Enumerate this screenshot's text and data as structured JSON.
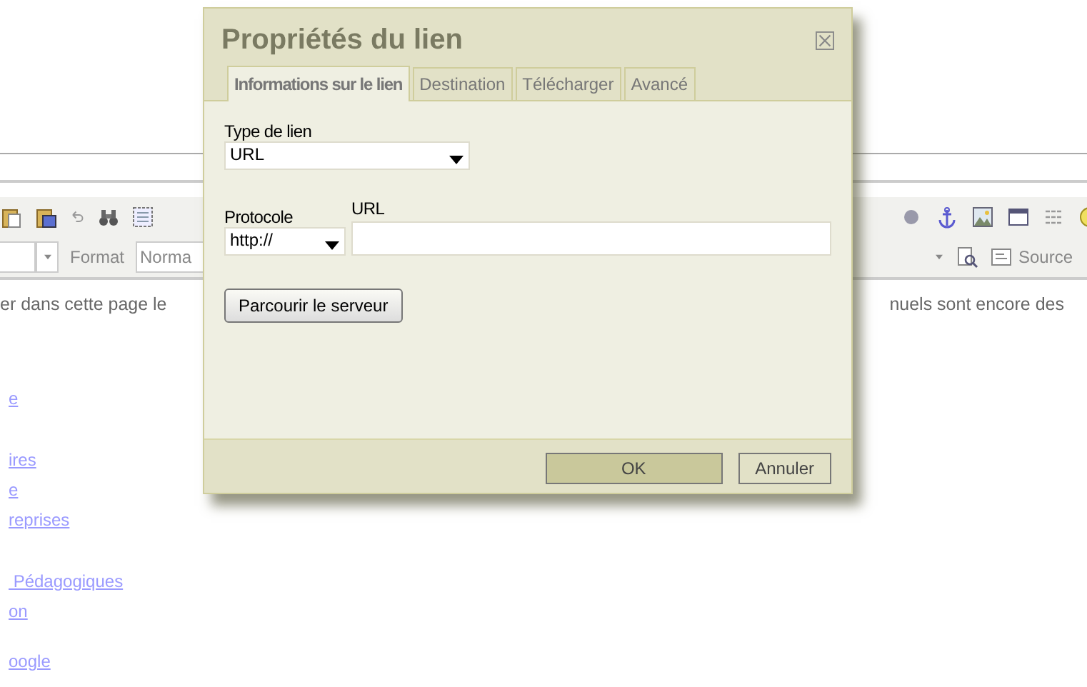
{
  "editor": {
    "format_label": "Format",
    "format_value": "Norma",
    "source_button": "Source",
    "text_left": "er dans cette page le",
    "text_right": "nuels sont encore des",
    "links": [
      "e",
      "ires",
      "e",
      "reprises",
      " Pédagogiques",
      "on",
      "oogle"
    ]
  },
  "dialog": {
    "title": "Propriétés du lien",
    "tabs": [
      {
        "label": "Informations sur le lien",
        "selected": true
      },
      {
        "label": "Destination",
        "selected": false
      },
      {
        "label": "Télécharger",
        "selected": false
      },
      {
        "label": "Avancé",
        "selected": false
      }
    ],
    "link_type": {
      "label": "Type de lien",
      "value": "URL"
    },
    "protocol": {
      "label": "Protocole",
      "value": "http://"
    },
    "url": {
      "label": "URL"
    },
    "browse_button": "Parcourir le serveur",
    "buttons": [
      "OK",
      "Annuler"
    ]
  }
}
